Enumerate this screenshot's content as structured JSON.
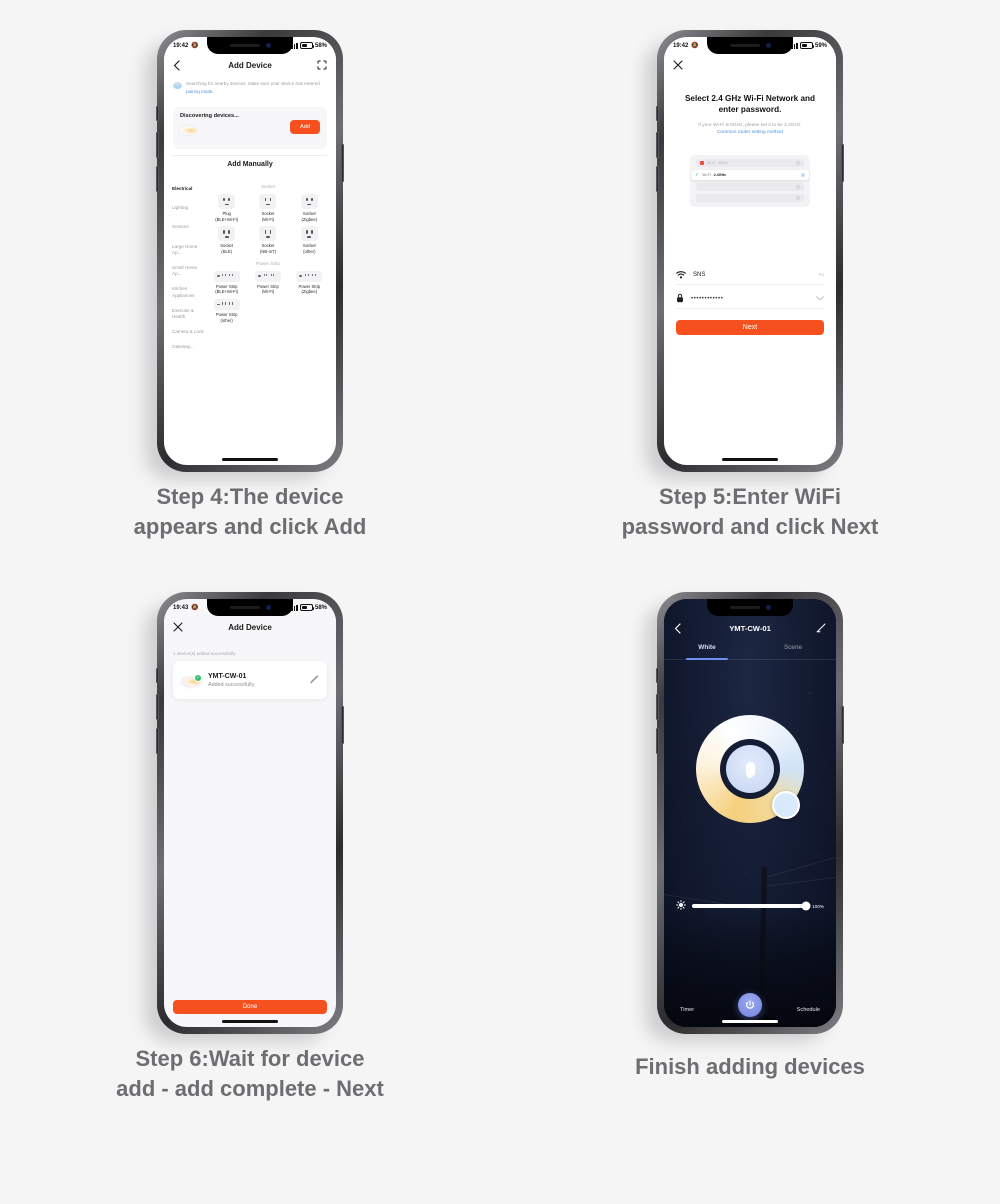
{
  "page": {
    "background": "#f5f5f5",
    "accent_orange": "#f5501e",
    "accent_blue": "#4a90e2",
    "caption_color": "#6e6e72"
  },
  "steps": [
    {
      "caption_line1": "Step 4:The device",
      "caption_line2": "appears and click Add"
    },
    {
      "caption_line1": "Step 5:Enter WiFi",
      "caption_line2": "password and click Next"
    },
    {
      "caption_line1": "Step 6:Wait for device",
      "caption_line2": "add - add complete - Next"
    },
    {
      "caption_line1": "Finish adding devices",
      "caption_line2": ""
    }
  ],
  "phone1": {
    "status": {
      "time": "19:42",
      "battery": "58%",
      "silent_icon": "mute-bell-icon"
    },
    "appbar": {
      "back_icon": "chevron-left-icon",
      "title": "Add Device",
      "scan_icon": "scan-qr-icon"
    },
    "searching": {
      "text": "Searching for nearby devices. Make sure your device has entered",
      "link": "pairing mode."
    },
    "discover": {
      "title": "Discovering devices...",
      "add_label": "Add",
      "device_icon": "ceiling-lamp-icon"
    },
    "add_manually_label": "Add Manually",
    "categories": [
      {
        "label": "Electrical",
        "active": true
      },
      {
        "label": "Lighting",
        "active": false
      },
      {
        "label": "Sensors",
        "active": false
      },
      {
        "label": "Large Home Ap...",
        "active": false
      },
      {
        "label": "Small Home Ap...",
        "active": false
      },
      {
        "label": "Kitchen Appliances",
        "active": false
      },
      {
        "label": "Exercise & Health",
        "active": false
      },
      {
        "label": "Camera & Lock",
        "active": false
      },
      {
        "label": "Gateway...",
        "active": false
      }
    ],
    "groups": [
      {
        "title": "Socket",
        "items": [
          {
            "name": "Plug",
            "proto": "(BLE+Wi-Fi)",
            "icon": "socket-icon"
          },
          {
            "name": "Socket",
            "proto": "(Wi-Fi)",
            "icon": "socket-icon"
          },
          {
            "name": "Socket",
            "proto": "(Zigbee)",
            "icon": "socket-icon"
          },
          {
            "name": "Socket",
            "proto": "(BLE)",
            "icon": "socket-icon"
          },
          {
            "name": "Socket",
            "proto": "(NB-IoT)",
            "icon": "socket-icon"
          },
          {
            "name": "Socket",
            "proto": "(other)",
            "icon": "socket-icon"
          }
        ]
      },
      {
        "title": "Power Strip",
        "items": [
          {
            "name": "Power Strip",
            "proto": "(BLE+Wi-Fi)",
            "icon": "power-strip-icon"
          },
          {
            "name": "Power Strip",
            "proto": "(Wi-Fi)",
            "icon": "power-strip-icon"
          },
          {
            "name": "Power Strip",
            "proto": "(Zigbee)",
            "icon": "power-strip-icon"
          },
          {
            "name": "Power Strip",
            "proto": "(other)",
            "icon": "power-strip-icon"
          }
        ]
      }
    ]
  },
  "phone2": {
    "status": {
      "time": "19:42",
      "battery": "59%",
      "silent_icon": "mute-bell-icon"
    },
    "close_icon": "close-x-icon",
    "title_line1": "Select 2.4 GHz Wi-Fi Network and",
    "title_line2": "enter password.",
    "subtitle": "If your Wi-Fi is 5GHz, please set it to be 2.4GHz.",
    "link": "Common router setting method",
    "router": {
      "row_5ghz": "Wi-Fi - 5GHz",
      "row_24_prefix": "Wi-Fi - ",
      "row_24_bold": "2.4GHz",
      "x_icon": "red-x-icon",
      "check_icon": "green-check-icon"
    },
    "ssid_field": {
      "icon": "wifi-icon",
      "value": "SNS",
      "tail": "Fu"
    },
    "password_field": {
      "icon": "lock-icon",
      "value": "••••••••••••",
      "tail_icon": "chevron-down-icon"
    },
    "next_label": "Next"
  },
  "phone3": {
    "status": {
      "time": "19:43",
      "battery": "58%",
      "silent_icon": "mute-bell-icon"
    },
    "close_icon": "close-x-icon",
    "title": "Add Device",
    "note": "1 device(s) added successfully",
    "device": {
      "name": "YMT-CW-01",
      "status": "Added successfully",
      "icon": "ceiling-lamp-icon",
      "badge_icon": "green-check-badge-icon",
      "edit_icon": "pencil-icon"
    },
    "done_label": "Done"
  },
  "phone4": {
    "back_icon": "chevron-left-icon",
    "title": "YMT-CW-01",
    "edit_icon": "pencil-icon",
    "tabs": [
      {
        "label": "White",
        "active": true
      },
      {
        "label": "Scene",
        "active": false
      }
    ],
    "color_wheel": {
      "icon": "color-temperature-ring",
      "bulb_icon": "bulb-icon"
    },
    "brightness": {
      "icon": "brightness-sun-icon",
      "value": "100%",
      "percent": 100
    },
    "bottom": {
      "timer_label": "Timer",
      "schedule_label": "Schedule",
      "power_icon": "power-icon"
    }
  }
}
